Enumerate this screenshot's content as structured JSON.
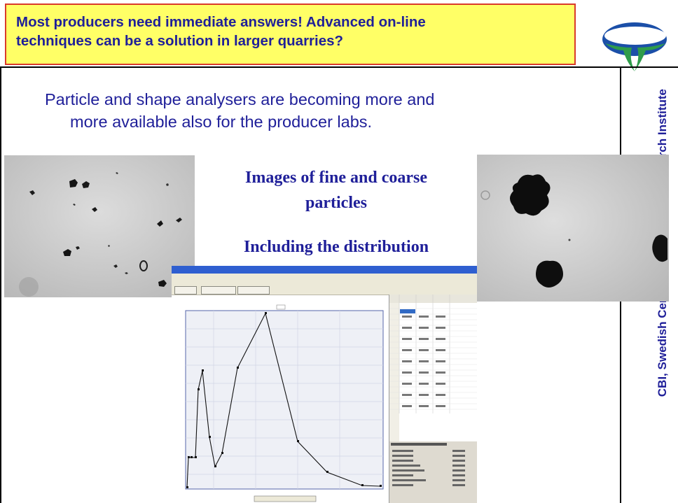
{
  "slide": {
    "title": {
      "line1": "Most producers need immediate answers! Advanced on-line",
      "line2": "techniques can be a solution in larger quarries?"
    },
    "side_label": "CBI, Swedish Cement and Concrete Research Institute",
    "body": {
      "line1": "Particle and shape analysers are becoming more and",
      "line2": "more available also for the producer labs."
    },
    "caption": {
      "line1": "Images of fine and coarse",
      "line2": "particles",
      "line3": "Including the distribution"
    }
  },
  "colors": {
    "title_background": "#ffff66",
    "title_border": "#d93a2b",
    "text_blue": "#1f1f99",
    "logo_blue": "#1b4fa8",
    "logo_green": "#2e9c4a"
  },
  "icons": {
    "logo": "cbi-logo-icon"
  }
}
